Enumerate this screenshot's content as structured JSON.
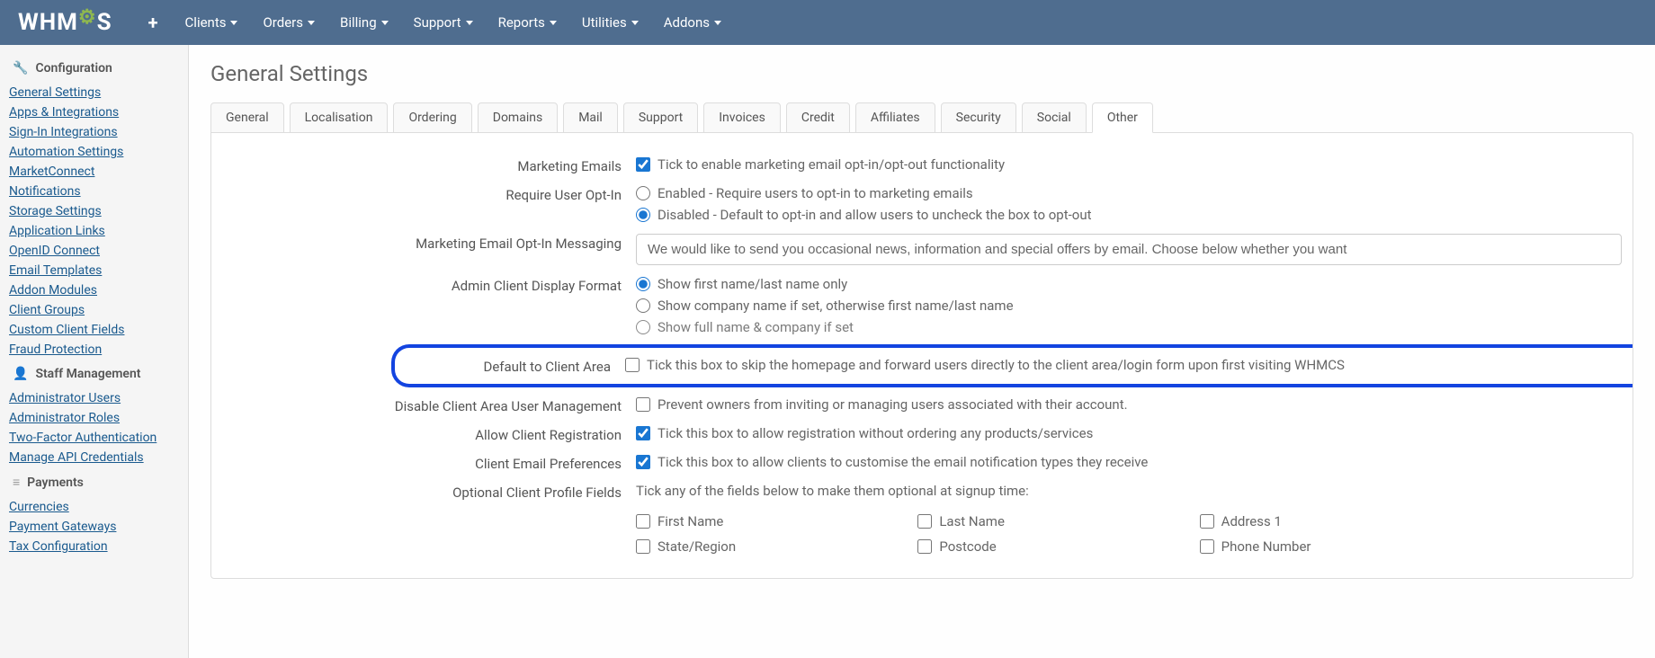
{
  "topnav": {
    "logo_prefix": "WHM",
    "logo_suffix": "S",
    "items": [
      "Clients",
      "Orders",
      "Billing",
      "Support",
      "Reports",
      "Utilities",
      "Addons"
    ]
  },
  "sidebar": {
    "sections": [
      {
        "icon": "wrench",
        "title": "Configuration",
        "links": [
          "General Settings",
          "Apps & Integrations",
          "Sign-In Integrations",
          "Automation Settings",
          "MarketConnect",
          "Notifications",
          "Storage Settings",
          "Application Links",
          "OpenID Connect",
          "Email Templates",
          "Addon Modules",
          "Client Groups",
          "Custom Client Fields",
          "Fraud Protection"
        ]
      },
      {
        "icon": "user",
        "title": "Staff Management",
        "links": [
          "Administrator Users",
          "Administrator Roles",
          "Two-Factor Authentication",
          "Manage API Credentials"
        ]
      },
      {
        "icon": "bars",
        "title": "Payments",
        "links": [
          "Currencies",
          "Payment Gateways",
          "Tax Configuration"
        ]
      }
    ]
  },
  "page": {
    "title": "General Settings"
  },
  "tabs": [
    "General",
    "Localisation",
    "Ordering",
    "Domains",
    "Mail",
    "Support",
    "Invoices",
    "Credit",
    "Affiliates",
    "Security",
    "Social",
    "Other"
  ],
  "active_tab": "Other",
  "form": {
    "marketing_emails": {
      "label": "Marketing Emails",
      "checked": true,
      "text": "Tick to enable marketing email opt-in/opt-out functionality"
    },
    "require_opt_in": {
      "label": "Require User Opt-In",
      "opt1": "Enabled - Require users to opt-in to marketing emails",
      "opt2": "Disabled - Default to opt-in and allow users to uncheck the box to opt-out",
      "selected": "opt2"
    },
    "opt_in_messaging": {
      "label": "Marketing Email Opt-In Messaging",
      "value": "We would like to send you occasional news, information and special offers by email. Choose below whether you want"
    },
    "admin_display": {
      "label": "Admin Client Display Format",
      "opt1": "Show first name/last name only",
      "opt2": "Show company name if set, otherwise first name/last name",
      "opt3": "Show full name & company if set",
      "selected": "opt1"
    },
    "default_client_area": {
      "label": "Default to Client Area",
      "checked": false,
      "text": "Tick this box to skip the homepage and forward users directly to the client area/login form upon first visiting WHMCS"
    },
    "disable_user_mgmt": {
      "label": "Disable Client Area User Management",
      "checked": false,
      "text": "Prevent owners from inviting or managing users associated with their account."
    },
    "allow_registration": {
      "label": "Allow Client Registration",
      "checked": true,
      "text": "Tick this box to allow registration without ordering any products/services"
    },
    "email_prefs": {
      "label": "Client Email Preferences",
      "checked": true,
      "text": "Tick this box to allow clients to customise the email notification types they receive"
    },
    "optional_fields": {
      "label": "Optional Client Profile Fields",
      "intro": "Tick any of the fields below to make them optional at signup time:",
      "fields": [
        "First Name",
        "Last Name",
        "Address 1",
        "State/Region",
        "Postcode",
        "Phone Number"
      ]
    }
  }
}
